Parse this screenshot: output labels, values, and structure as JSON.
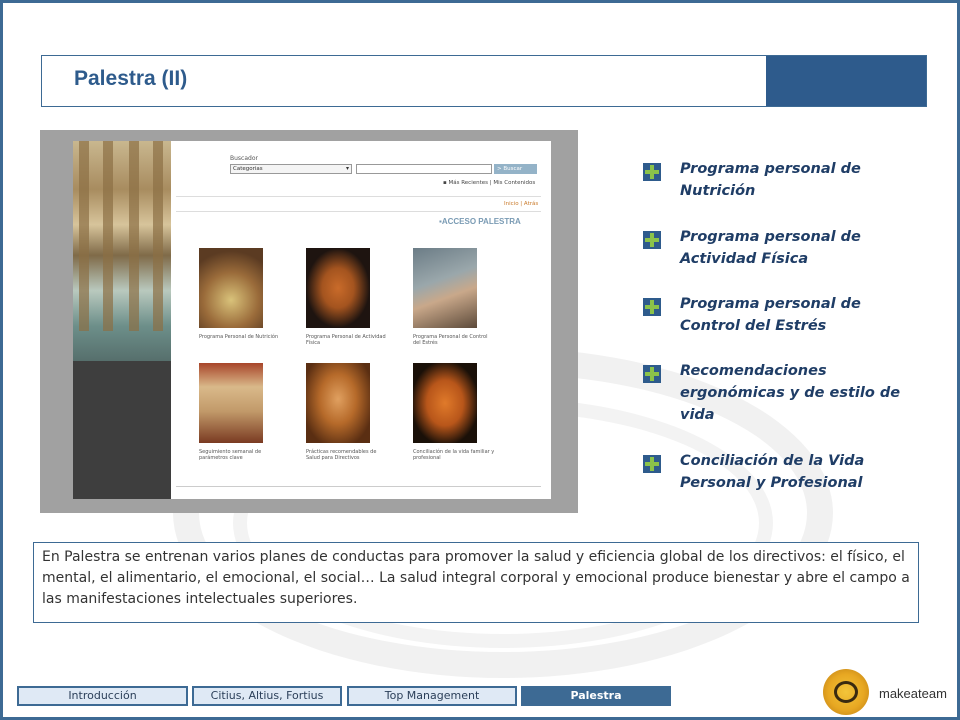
{
  "title": "Palestra (II)",
  "colors": {
    "brand_blue": "#2e5b8c",
    "plus_green": "#8bc34a",
    "nav_active": "#3d6a94"
  },
  "screenshot": {
    "search_label": "Buscador",
    "category_select": "Categorias",
    "search_button": "> Buscar",
    "recent_links": "Más Recientes | Mis Contenidos",
    "breadcrumbs": "Inicio | Atrás",
    "section_title": "ACCESO PALESTRA",
    "thumbnails": [
      {
        "caption": "Programa Personal de Nutrición",
        "icon": "fruit-mosaic-image"
      },
      {
        "caption": "Programa Personal de Actividad Física",
        "icon": "greek-vase-athlete-image"
      },
      {
        "caption": "Programa Personal de Control del Estrés",
        "icon": "seated-figure-painting-image"
      },
      {
        "caption": "Seguimiento semanal de parámetros clave",
        "icon": "roman-fresco-image"
      },
      {
        "caption": "Prácticas recomendables de Salud para Directivos",
        "icon": "classical-statue-image"
      },
      {
        "caption": "Conciliación de la vida familiar y profesional",
        "icon": "greek-amphora-image"
      }
    ]
  },
  "programs": [
    "Programa personal de Nutrición",
    "Programa personal de Actividad Física",
    "Programa personal de Control del Estrés",
    "Recomendaciones ergonómicas y de estilo de vida",
    "Conciliación de la Vida Personal y Profesional"
  ],
  "description": "En Palestra se entrenan varios planes de conductas para promover la salud y eficiencia global de los directivos: el físico, el mental, el alimentario, el emocional, el social… La salud integral corporal y emocional produce bienestar y abre el campo a las manifestaciones intelectuales superiores.",
  "nav": {
    "tabs": [
      "Introducción",
      "Citius, Altius, Fortius",
      "Top Management",
      "Palestra"
    ],
    "active": "Palestra"
  },
  "logo": {
    "text": "makeateam"
  }
}
